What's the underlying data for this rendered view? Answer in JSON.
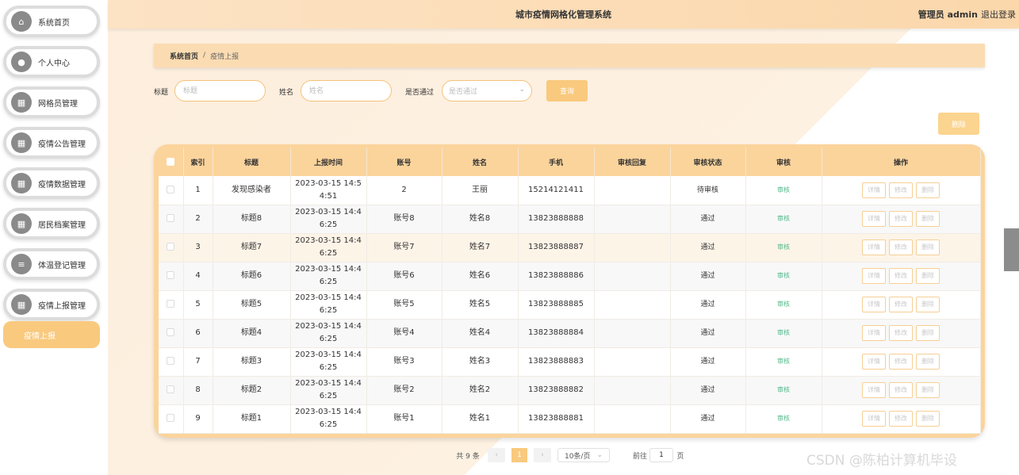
{
  "app": {
    "title": "城市疫情网格化管理系统",
    "user": "管理员 admin",
    "logout": "退出登录"
  },
  "sidebar": {
    "items": [
      {
        "label": "系统首页",
        "icon": "home-icon"
      },
      {
        "label": "个人中心",
        "icon": "user-icon"
      },
      {
        "label": "网格员管理",
        "icon": "grid-icon"
      },
      {
        "label": "疫情公告管理",
        "icon": "grid-icon"
      },
      {
        "label": "疫情数据管理",
        "icon": "grid-icon"
      },
      {
        "label": "居民档案管理",
        "icon": "grid-icon"
      },
      {
        "label": "体温登记管理",
        "icon": "list-icon"
      },
      {
        "label": "疫情上报管理",
        "icon": "grid-icon"
      }
    ],
    "sub_item": "疫情上报"
  },
  "breadcrumb": {
    "home": "系统首页",
    "separator": "/",
    "current": "疫情上报"
  },
  "search": {
    "title_label": "标题",
    "title_placeholder": "标题",
    "name_label": "姓名",
    "name_placeholder": "姓名",
    "passed_label": "是否通过",
    "passed_placeholder": "是否通过",
    "query_button": "查询"
  },
  "delete_button": "删除",
  "table": {
    "headers": [
      "索引",
      "标题",
      "上报时间",
      "账号",
      "姓名",
      "手机",
      "审核回复",
      "审核状态",
      "审核",
      "操作"
    ],
    "rows": [
      {
        "index": "1",
        "title": "发现感染者",
        "time": "2023-03-15 14:5\n4:51",
        "account": "2",
        "name": "王丽",
        "phone": "15214121411",
        "reply": "",
        "status": "待审核",
        "review": "审核"
      },
      {
        "index": "2",
        "title": "标题8",
        "time": "2023-03-15 14:4\n6:25",
        "account": "账号8",
        "name": "姓名8",
        "phone": "13823888888",
        "reply": "",
        "status": "通过",
        "review": "审核"
      },
      {
        "index": "3",
        "title": "标题7",
        "time": "2023-03-15 14:4\n6:25",
        "account": "账号7",
        "name": "姓名7",
        "phone": "13823888887",
        "reply": "",
        "status": "通过",
        "review": "审核"
      },
      {
        "index": "4",
        "title": "标题6",
        "time": "2023-03-15 14:4\n6:25",
        "account": "账号6",
        "name": "姓名6",
        "phone": "13823888886",
        "reply": "",
        "status": "通过",
        "review": "审核"
      },
      {
        "index": "5",
        "title": "标题5",
        "time": "2023-03-15 14:4\n6:25",
        "account": "账号5",
        "name": "姓名5",
        "phone": "13823888885",
        "reply": "",
        "status": "通过",
        "review": "审核"
      },
      {
        "index": "6",
        "title": "标题4",
        "time": "2023-03-15 14:4\n6:25",
        "account": "账号4",
        "name": "姓名4",
        "phone": "13823888884",
        "reply": "",
        "status": "通过",
        "review": "审核"
      },
      {
        "index": "7",
        "title": "标题3",
        "time": "2023-03-15 14:4\n6:25",
        "account": "账号3",
        "name": "姓名3",
        "phone": "13823888883",
        "reply": "",
        "status": "通过",
        "review": "审核"
      },
      {
        "index": "8",
        "title": "标题2",
        "time": "2023-03-15 14:4\n6:25",
        "account": "账号2",
        "name": "姓名2",
        "phone": "13823888882",
        "reply": "",
        "status": "通过",
        "review": "审核"
      },
      {
        "index": "9",
        "title": "标题1",
        "time": "2023-03-15 14:4\n6:25",
        "account": "账号1",
        "name": "姓名1",
        "phone": "13823888881",
        "reply": "",
        "status": "通过",
        "review": "审核"
      }
    ],
    "actions": {
      "detail": "详情",
      "edit": "修改",
      "delete": "删除"
    }
  },
  "pagination": {
    "total": "共 9 条",
    "prev": "‹",
    "page": "1",
    "next": "›",
    "page_size": "10条/页",
    "goto_label": "前往",
    "goto_value": "1",
    "goto_unit": "页"
  },
  "watermark": "CSDN @陈柏计算机毕设",
  "colors": {
    "accent": "#f9c97e",
    "header": "#fbd49c",
    "review_link": "#52b98a"
  }
}
